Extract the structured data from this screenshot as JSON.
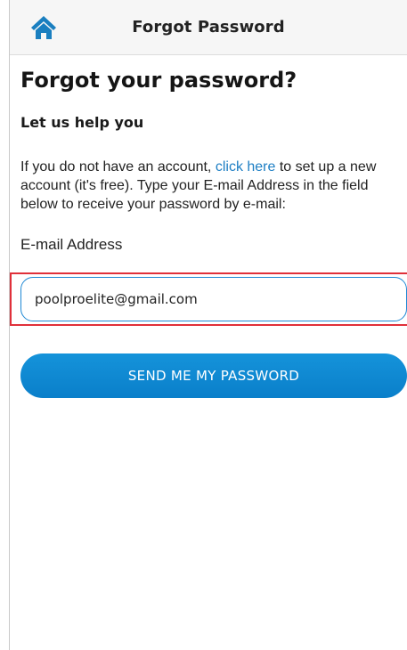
{
  "header": {
    "title": "Forgot Password",
    "home_icon": "home-icon"
  },
  "main": {
    "heading": "Forgot your password?",
    "subheading": "Let us help you",
    "description_before_link": "If you do not have an account, ",
    "link_text": "click here",
    "description_after_link": " to set up a new account (it's free). Type your E-mail Address in the field below to receive your password by e-mail:",
    "email_label": "E-mail Address",
    "email_value": "poolproelite@gmail.com",
    "submit_label": "SEND ME MY PASSWORD"
  },
  "colors": {
    "accent": "#1e88d4",
    "link": "#1e7fc4",
    "highlight_border": "#e0303a",
    "button_bg": "#0d86d0"
  }
}
